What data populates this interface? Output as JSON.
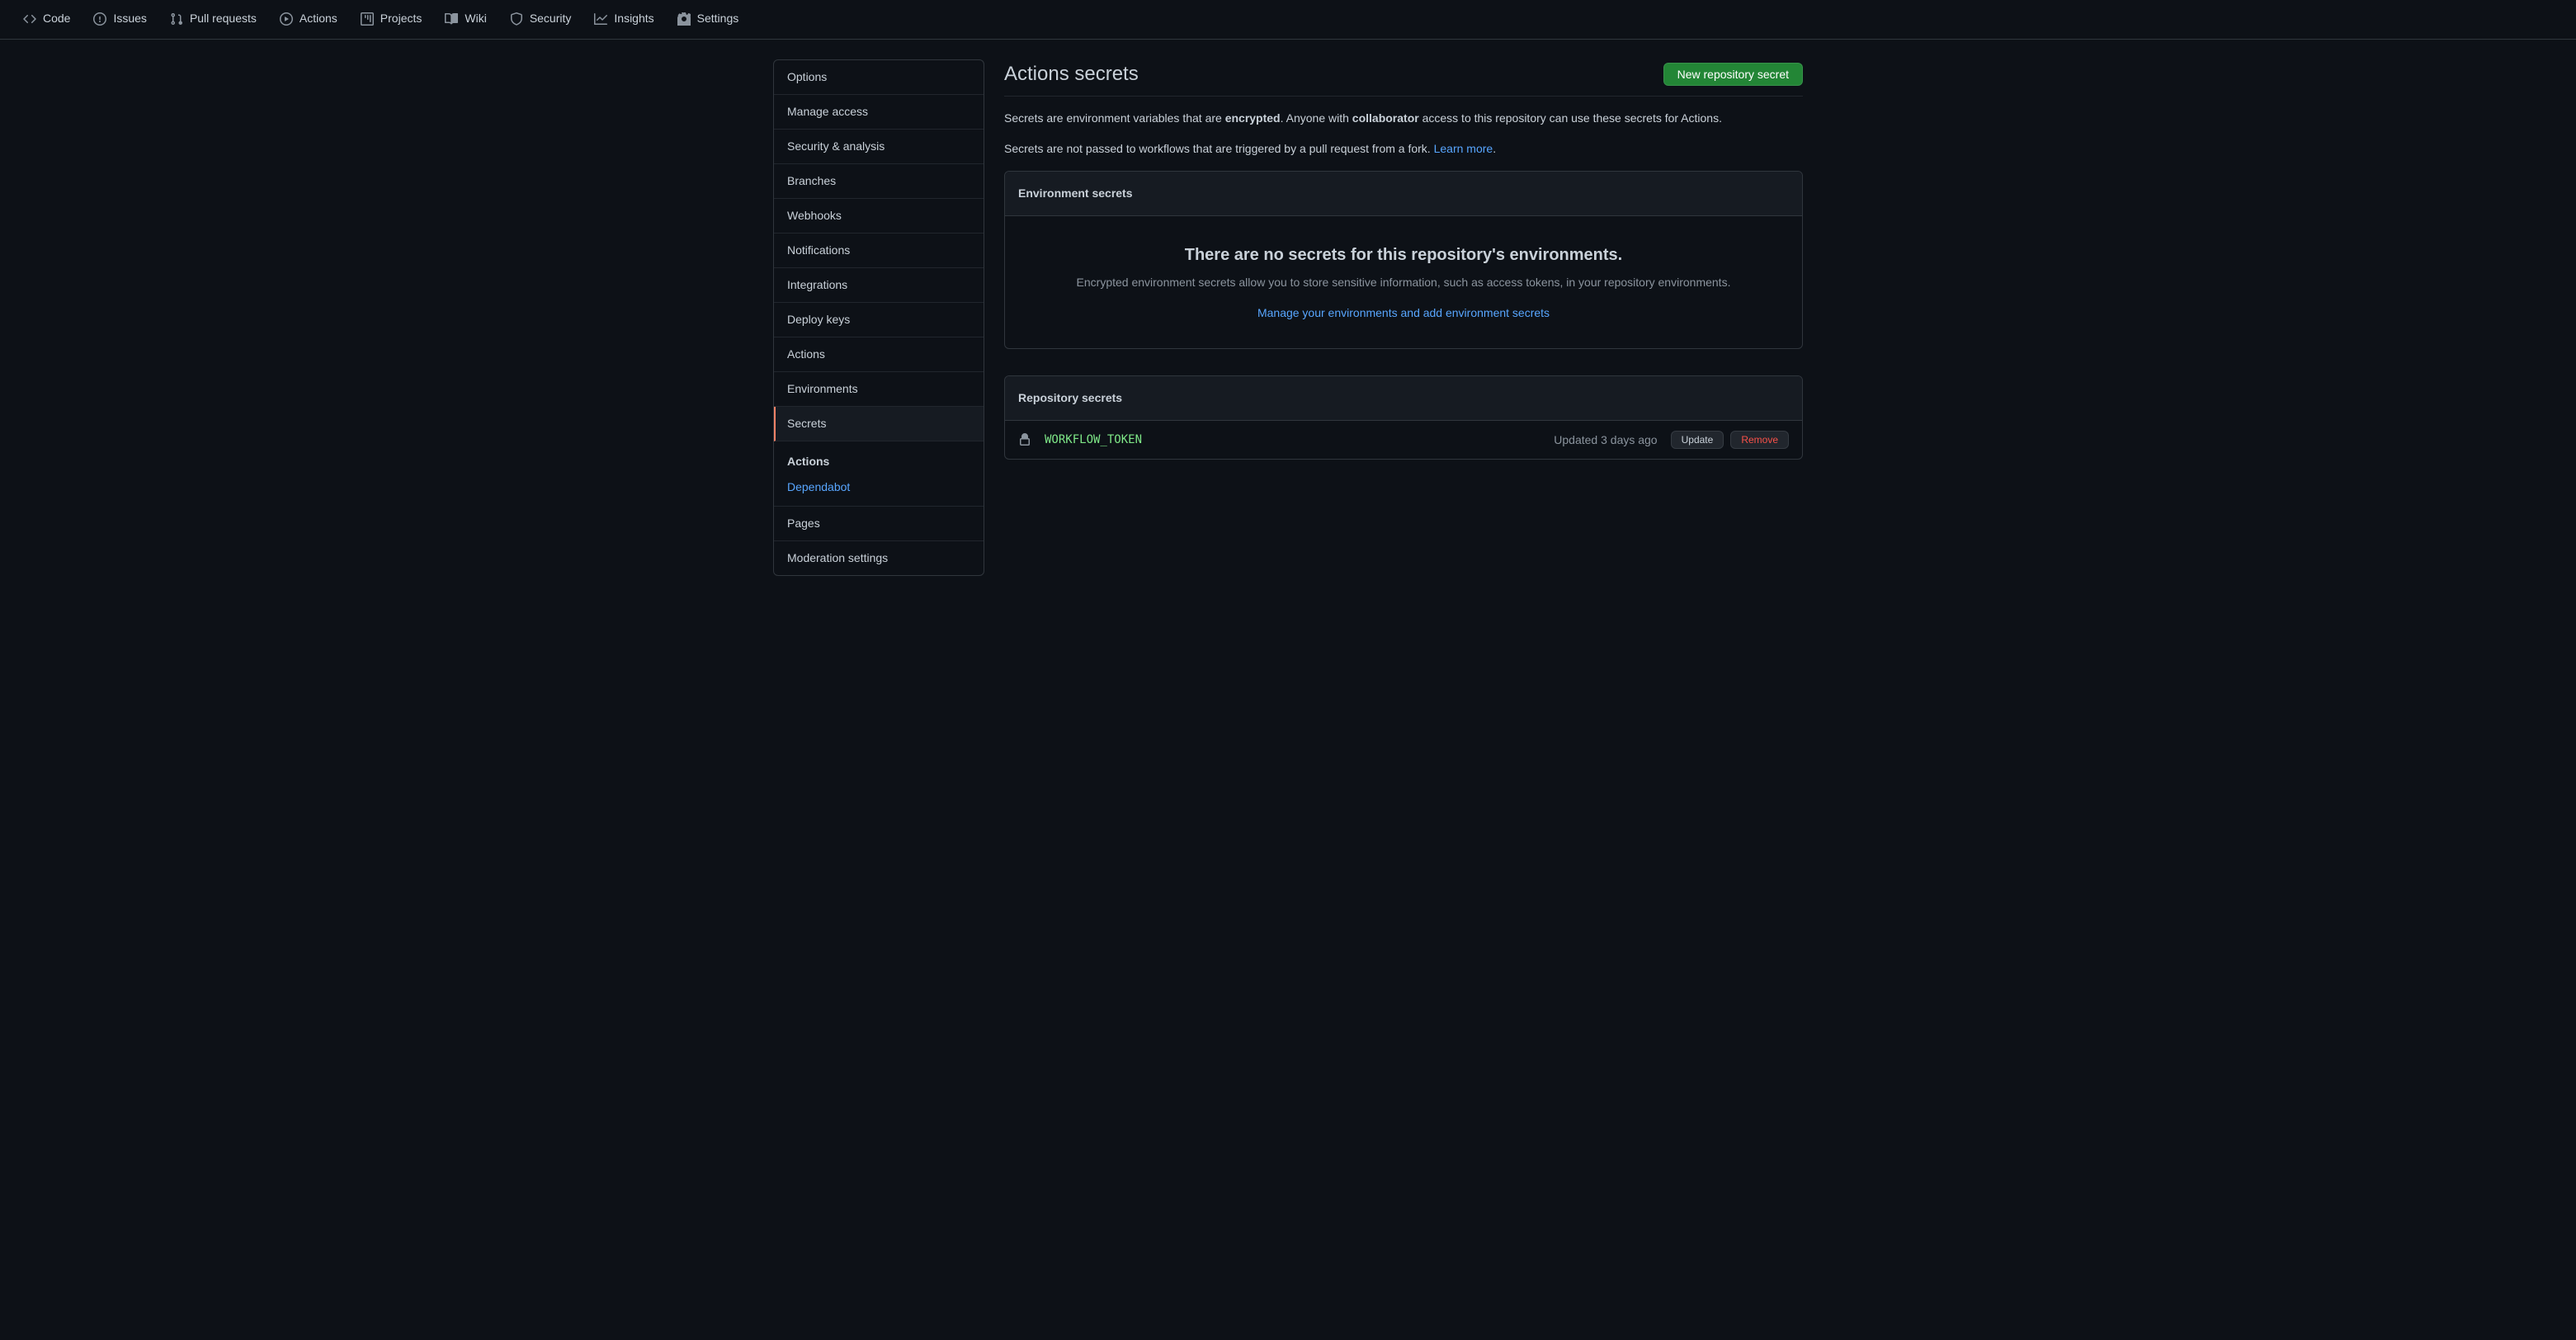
{
  "topnav": {
    "code": "Code",
    "issues": "Issues",
    "pulls": "Pull requests",
    "actions": "Actions",
    "projects": "Projects",
    "wiki": "Wiki",
    "security": "Security",
    "insights": "Insights",
    "settings": "Settings"
  },
  "sidebar": {
    "options": "Options",
    "manage_access": "Manage access",
    "security_analysis": "Security & analysis",
    "branches": "Branches",
    "webhooks": "Webhooks",
    "notifications": "Notifications",
    "integrations": "Integrations",
    "deploy_keys": "Deploy keys",
    "actions": "Actions",
    "environments": "Environments",
    "secrets": "Secrets",
    "secrets_sub": {
      "header": "Actions",
      "dependabot": "Dependabot"
    },
    "pages": "Pages",
    "moderation": "Moderation settings"
  },
  "main": {
    "title": "Actions secrets",
    "new_secret_btn": "New repository secret",
    "desc1_pre": "Secrets are environment variables that are ",
    "desc1_enc": "encrypted",
    "desc1_mid": ". Anyone with ",
    "desc1_collab": "collaborator",
    "desc1_post": " access to this repository can use these secrets for Actions.",
    "desc2_pre": "Secrets are not passed to workflows that are triggered by a pull request from a fork. ",
    "desc2_link": "Learn more",
    "desc2_post": "."
  },
  "env_panel": {
    "header": "Environment secrets",
    "blank_title": "There are no secrets for this repository's environments.",
    "blank_sub": "Encrypted environment secrets allow you to store sensitive information, such as access tokens, in your repository environments.",
    "blank_link": "Manage your environments and add environment secrets"
  },
  "repo_panel": {
    "header": "Repository secrets",
    "secrets": [
      {
        "name": "WORKFLOW_TOKEN",
        "updated": "Updated 3 days ago",
        "update_btn": "Update",
        "remove_btn": "Remove"
      }
    ]
  }
}
